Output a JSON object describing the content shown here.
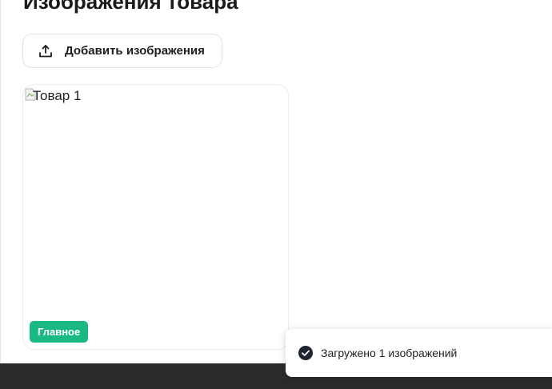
{
  "page": {
    "title": "Изображения товара"
  },
  "toolbar": {
    "add_images_label": "Добавить изображения",
    "add_images_icon": "upload-icon"
  },
  "images": [
    {
      "alt": "Товар 1",
      "badge": "Главное",
      "badge_color": "#1ab983"
    }
  ],
  "toast": {
    "message": "Загружено 1 изображений",
    "icon": "check-circle-icon"
  },
  "colors": {
    "accent": "#1ab983",
    "footer": "#2b2b2b"
  }
}
